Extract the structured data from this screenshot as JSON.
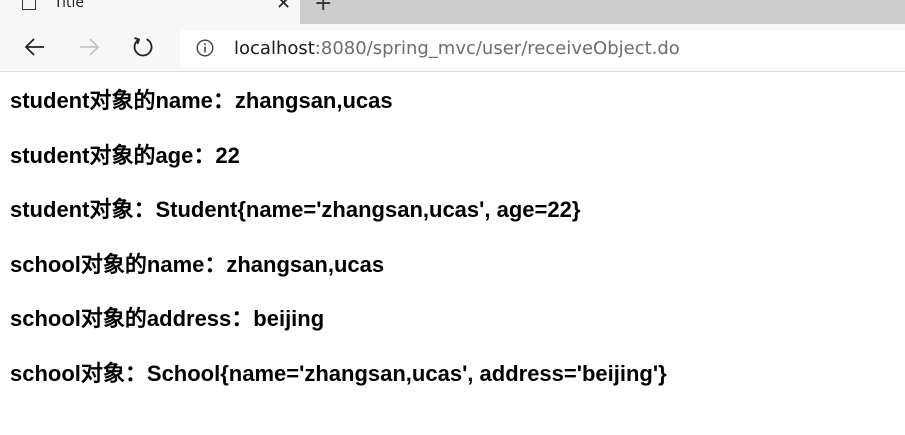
{
  "tab": {
    "title": "Title",
    "close_glyph": "✕",
    "new_tab_glyph": "+"
  },
  "toolbar": {
    "back_icon": "back-arrow-icon",
    "forward_icon": "forward-arrow-icon",
    "refresh_icon": "refresh-icon"
  },
  "address": {
    "host": "localhost",
    "rest": ":8080/spring_mvc/user/receiveObject.do"
  },
  "content": {
    "lines": [
      "student对象的name：zhangsan,ucas",
      "student对象的age：22",
      "student对象：Student{name='zhangsan,ucas', age=22}",
      "school对象的name：zhangsan,ucas",
      "school对象的address：beijing",
      "school对象：School{name='zhangsan,ucas', address='beijing'}"
    ]
  }
}
